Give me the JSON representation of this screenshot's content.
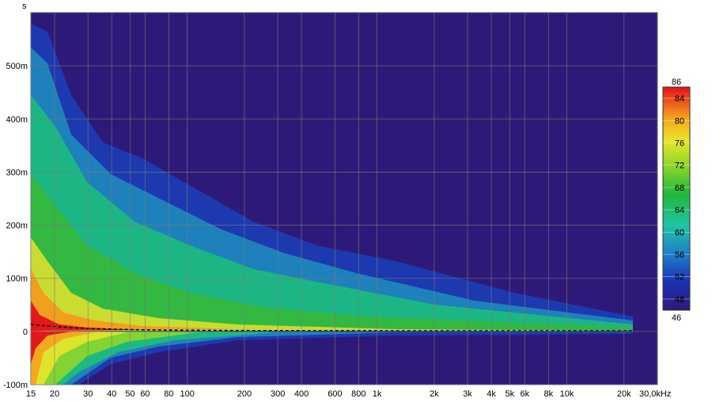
{
  "chart_data": {
    "type": "heatmap",
    "title": "",
    "xlabel": "Hz",
    "ylabel": "s",
    "x_scale": "log",
    "xlim": [
      15,
      30000
    ],
    "ylim": [
      -0.1,
      0.6
    ],
    "x_ticks": [
      15,
      20,
      30,
      40,
      50,
      60,
      80,
      100,
      200,
      300,
      400,
      600,
      800,
      1000,
      2000,
      3000,
      4000,
      5000,
      6000,
      8000,
      10000,
      20000,
      30000
    ],
    "x_tick_labels": [
      "15",
      "20",
      "30",
      "40",
      "50",
      "60",
      "80",
      "100",
      "200",
      "300",
      "400",
      "600",
      "800",
      "1k",
      "2k",
      "3k",
      "4k",
      "5k",
      "6k",
      "8k",
      "10k",
      "20k",
      "30,0kHz"
    ],
    "y_ticks": [
      -0.1,
      0,
      0.1,
      0.2,
      0.3,
      0.4,
      0.5
    ],
    "y_tick_labels": [
      "-100m",
      "0",
      "100m",
      "200m",
      "300m",
      "400m",
      "500m"
    ],
    "colorbar": {
      "min": 46,
      "max": 86,
      "ticks": [
        48,
        52,
        56,
        60,
        64,
        68,
        72,
        76,
        80,
        84
      ],
      "min_label": "46",
      "max_label": "86"
    },
    "grid": true,
    "background_color": "#2d1a78",
    "approx_decay_upper_ms": [
      {
        "freq": 15,
        "t": 0.55
      },
      {
        "freq": 30,
        "t": 0.4
      },
      {
        "freq": 60,
        "t": 0.3
      },
      {
        "freq": 150,
        "t": 0.25
      },
      {
        "freq": 300,
        "t": 0.2
      },
      {
        "freq": 1000,
        "t": 0.14
      },
      {
        "freq": 4000,
        "t": 0.08
      },
      {
        "freq": 20000,
        "t": 0.03
      }
    ]
  }
}
